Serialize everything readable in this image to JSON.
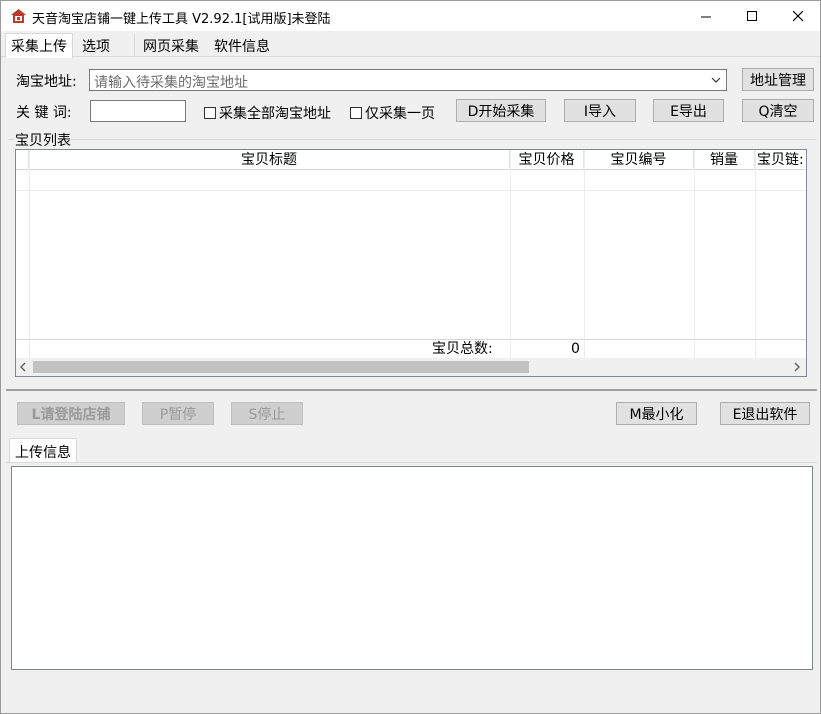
{
  "window": {
    "title": "天音淘宝店铺一键上传工具 V2.92.1[试用版]未登陆",
    "minimize_glyph": "—",
    "maximize_glyph": "☐",
    "close_glyph": "✕"
  },
  "tabs": [
    "采集上传",
    "选项",
    "网页采集",
    "软件信息"
  ],
  "form": {
    "url_label": "淘宝地址:",
    "url_placeholder": "请输入待采集的淘宝地址",
    "address_manage_button": "地址管理",
    "keyword_label": "关 键 词:",
    "keyword_value": "",
    "collect_all_checkbox": "采集全部淘宝地址",
    "one_page_checkbox": "仅采集一页",
    "start_button": "D开始采集",
    "import_button": "I导入",
    "export_button": "E导出",
    "clear_button": "Q清空"
  },
  "list": {
    "group_label": "宝贝列表",
    "columns": [
      "宝贝标题",
      "宝贝价格",
      "宝贝编号",
      "销量",
      "宝贝链:"
    ],
    "total_label": "宝贝总数:",
    "total_value": "0"
  },
  "actions": {
    "login_button": "L请登陆店铺",
    "pause_button": "P暂停",
    "stop_button": "S停止",
    "minimize_button": "M最小化",
    "exit_button": "E退出软件"
  },
  "upload_tab": "上传信息",
  "colors": {
    "accent_icon": "#c0392b"
  }
}
